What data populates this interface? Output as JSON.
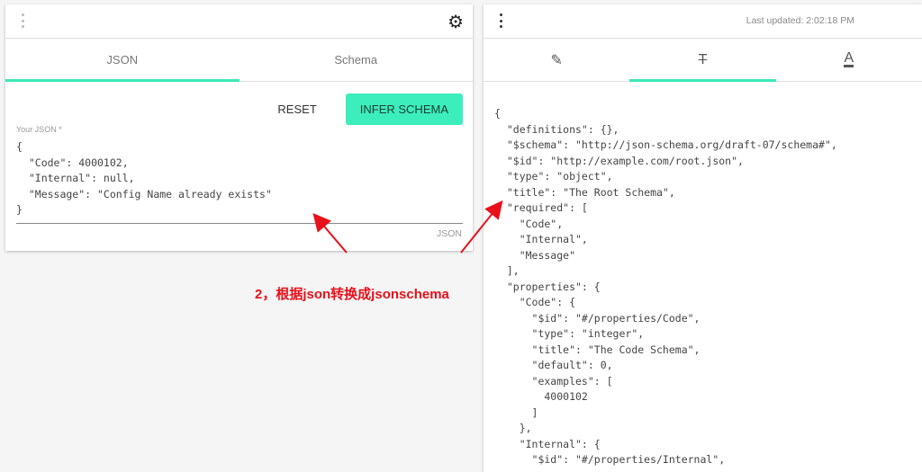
{
  "left": {
    "tabs": [
      "JSON",
      "Schema"
    ],
    "reset_label": "RESET",
    "infer_label": "INFER SCHEMA",
    "field_label": "Your JSON *",
    "json_value": "{\n  \"Code\": 4000102,\n  \"Internal\": null,\n  \"Message\": \"Config Name already exists\"\n}",
    "field_hint": "JSON"
  },
  "right": {
    "last_updated": "Last updated: 2:02:18 PM",
    "tab_icons": [
      "pencil-icon",
      "clear-format-icon",
      "text-color-icon"
    ],
    "output": "{\n  \"definitions\": {},\n  \"$schema\": \"http://json-schema.org/draft-07/schema#\",\n  \"$id\": \"http://example.com/root.json\",\n  \"type\": \"object\",\n  \"title\": \"The Root Schema\",\n  \"required\": [\n    \"Code\",\n    \"Internal\",\n    \"Message\"\n  ],\n  \"properties\": {\n    \"Code\": {\n      \"$id\": \"#/properties/Code\",\n      \"type\": \"integer\",\n      \"title\": \"The Code Schema\",\n      \"default\": 0,\n      \"examples\": [\n        4000102\n      ]\n    },\n    \"Internal\": {\n      \"$id\": \"#/properties/Internal\","
  },
  "annotation": "2，根据json转换成jsonschema",
  "accent": "#3ceebb"
}
